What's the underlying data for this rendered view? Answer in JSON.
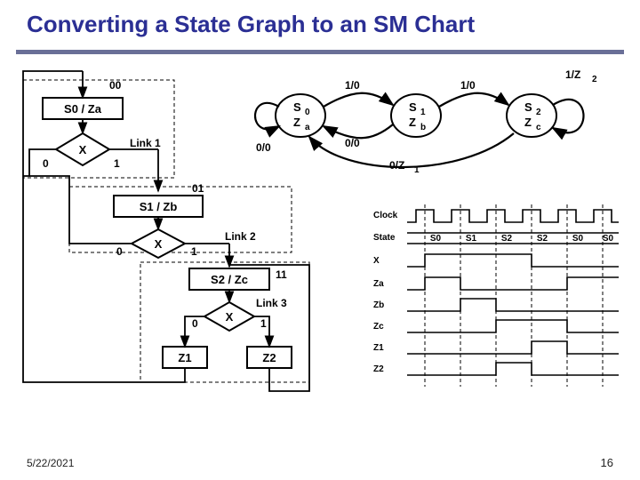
{
  "title": "Converting a State Graph to an SM Chart",
  "footer": {
    "date": "5/22/2021",
    "page": "16"
  },
  "sm": {
    "s0": {
      "code": "00",
      "label": "S0 / Za"
    },
    "s1": {
      "code": "01",
      "label": "S1 / Zb"
    },
    "s2": {
      "code": "11",
      "label": "S2 / Zc"
    },
    "dec": "X",
    "out0": "0",
    "out1": "1",
    "link1": "Link 1",
    "link2": "Link 2",
    "link3": "Link 3",
    "z1": "Z1",
    "z2": "Z2"
  },
  "graph": {
    "n0": "S",
    "n0s": "0",
    "n0z": "Z",
    "n0zs": "a",
    "n1": "S",
    "n1s": "1",
    "n1z": "Z",
    "n1zs": "b",
    "n2": "S",
    "n2s": "2",
    "n2z": "Z",
    "n2zs": "c",
    "e00": "1/0",
    "e01": "0/0",
    "e12": "1/0",
    "e22": "1/Z",
    "e22s": "2",
    "eself0": "0/0",
    "e10": "0/Z",
    "e10s": "1"
  },
  "timing": {
    "labels": {
      "clock": "Clock",
      "state": "State",
      "x": "X",
      "za": "Za",
      "zb": "Zb",
      "zc": "Zc",
      "z1": "Z1",
      "z2": "Z2"
    },
    "states": [
      "S0",
      "S1",
      "S2",
      "S2",
      "S0",
      "S0"
    ]
  }
}
